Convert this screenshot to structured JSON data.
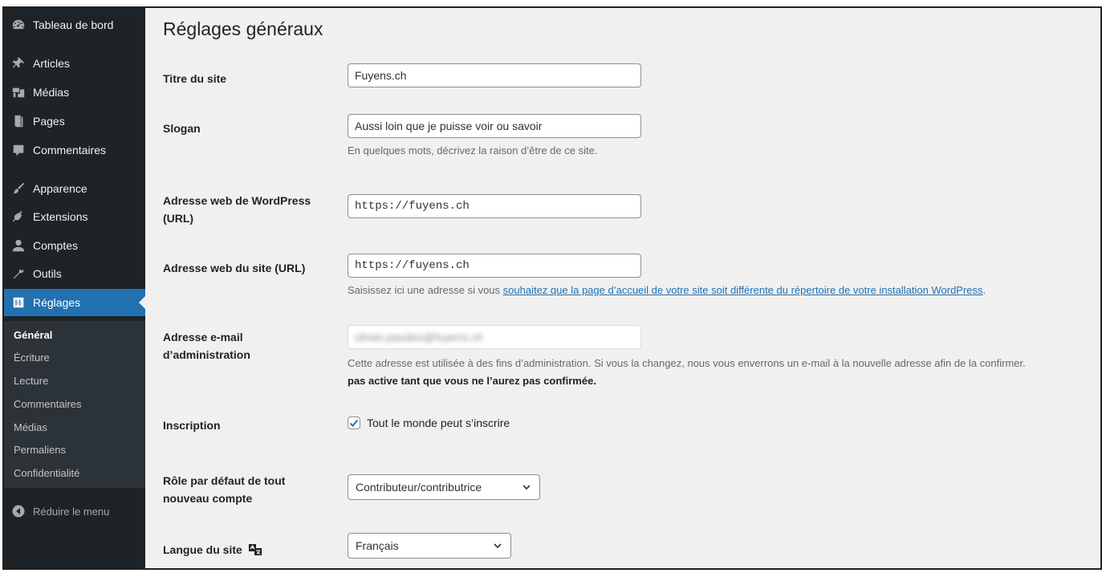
{
  "colors": {
    "sidebar_bg": "#1d2327",
    "submenu_bg": "#2c3338",
    "accent": "#2271b1",
    "content_bg": "#f0f0f1"
  },
  "sidebar": {
    "items": [
      {
        "label": "Tableau de bord",
        "icon": "dashboard-icon"
      },
      {
        "label": "Articles",
        "icon": "pin-icon"
      },
      {
        "label": "Médias",
        "icon": "media-icon"
      },
      {
        "label": "Pages",
        "icon": "page-icon"
      },
      {
        "label": "Commentaires",
        "icon": "comment-icon"
      },
      {
        "label": "Apparence",
        "icon": "brush-icon"
      },
      {
        "label": "Extensions",
        "icon": "plugin-icon"
      },
      {
        "label": "Comptes",
        "icon": "user-icon"
      },
      {
        "label": "Outils",
        "icon": "wrench-icon"
      },
      {
        "label": "Réglages",
        "icon": "settings-icon"
      }
    ],
    "submenu": [
      "Général",
      "Écriture",
      "Lecture",
      "Commentaires",
      "Médias",
      "Permaliens",
      "Confidentialité"
    ],
    "collapse_label": "Réduire le menu"
  },
  "main": {
    "title": "Réglages généraux",
    "site_title": {
      "label": "Titre du site",
      "value": "Fuyens.ch"
    },
    "tagline": {
      "label": "Slogan",
      "value": "Aussi loin que je puisse voir ou savoir",
      "description": "En quelques mots, décrivez la raison d’être de ce site."
    },
    "wp_url": {
      "label": "Adresse web de WordPress (URL)",
      "value": "https://fuyens.ch"
    },
    "site_url": {
      "label": "Adresse web du site (URL)",
      "value": "https://fuyens.ch",
      "desc_before": "Saisissez ici une adresse si vous ",
      "desc_link": "souhaitez que la page d’accueil de votre site soit différente du répertoire de votre installation WordPress",
      "desc_after": "."
    },
    "admin_email": {
      "label": "Adresse e-mail d’administration",
      "value": "olivier.paudex@fuyens.ch",
      "description_1": "Cette adresse est utilisée à des fins d’administration. Si vous la changez, nous vous enverrons un e-mail à la nouvelle adresse afin de la confirmer.",
      "description_2": "pas active tant que vous ne l’aurez pas confirmée."
    },
    "membership": {
      "label": "Inscription",
      "checkbox_label": "Tout le monde peut s’inscrire",
      "checked": true
    },
    "default_role": {
      "label": "Rôle par défaut de tout nouveau compte",
      "value": "Contributeur/contributrice"
    },
    "site_language": {
      "label": "Langue du site",
      "value": "Français"
    }
  }
}
